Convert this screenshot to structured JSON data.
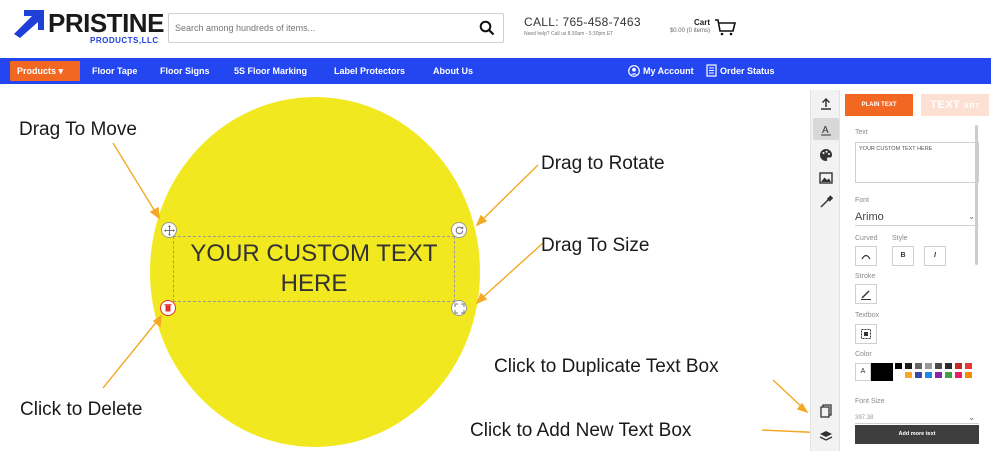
{
  "header": {
    "logo_name": "PRISTINE",
    "logo_sub": "PRODUCTS,LLC",
    "search_placeholder": "Search among hundreds of items...",
    "call": "CALL: 765-458-7463",
    "call_sub": "Need help? Call us 8:30am - 5:30pm ET",
    "cart_label": "Cart",
    "cart_summary": "$0.00 (0 items)"
  },
  "nav": {
    "products": "Products ▾",
    "links": [
      "Floor Tape",
      "Floor Signs",
      "5S Floor Marking",
      "Label Protectors",
      "About Us"
    ],
    "my_account": "My Account",
    "order_status": "Order Status"
  },
  "canvas": {
    "text_line1": "YOUR CUSTOM TEXT",
    "text_line2": "HERE",
    "circle_color": "#f1e820"
  },
  "annotations": {
    "move": "Drag To Move",
    "rotate": "Drag to Rotate",
    "size": "Drag To Size",
    "delete": "Click to Delete",
    "duplicate": "Click to Duplicate Text Box",
    "add_new": "Click to Add New Text Box"
  },
  "panel": {
    "plain_text": "PLAIN TEXT",
    "text_art": "TEXT",
    "text_art_small": "ART",
    "text_label": "Text",
    "text_value": "YOUR CUSTOM TEXT HERE",
    "font_label": "Font",
    "font_value": "Arimo",
    "curved_label": "Curved",
    "style_label": "Style",
    "bold": "B",
    "italic": "I",
    "stroke_label": "Stroke",
    "textbox_label": "Textbox",
    "color_label": "Color",
    "color_letter": "A",
    "fontsize_label": "Font Size",
    "fontsize_value": "397.38",
    "add_more": "Add more text",
    "swatches": [
      "#000000",
      "#1a1a1a",
      "#666666",
      "#999999",
      "#4a4a4a",
      "#2b2b2b",
      "#c62828",
      "#e53935",
      "#ffffff",
      "#f9a825",
      "#3949ab",
      "#1e88e5",
      "#8e24aa",
      "#43a047",
      "#e91e63",
      "#fb8c00"
    ]
  }
}
